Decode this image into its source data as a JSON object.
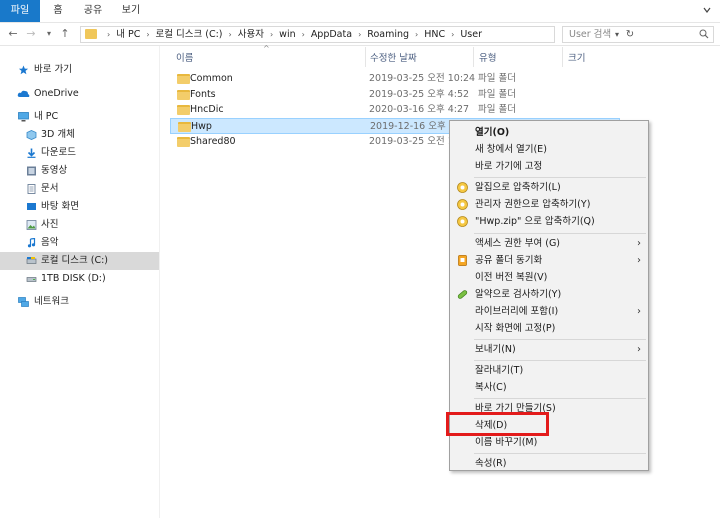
{
  "ribbon": {
    "tabs": [
      {
        "label": "파일",
        "active": true
      },
      {
        "label": "홈",
        "active": false
      },
      {
        "label": "공유",
        "active": false
      },
      {
        "label": "보기",
        "active": false
      }
    ]
  },
  "address": {
    "crumbs": [
      "내 PC",
      "로컬 디스크 (C:)",
      "사용자",
      "win",
      "AppData",
      "Roaming",
      "HNC",
      "User"
    ]
  },
  "search": {
    "placeholder": "User 검색"
  },
  "sidebar": {
    "items": [
      {
        "label": "바로 가기",
        "icon": "star-icon"
      },
      {
        "label": "OneDrive",
        "icon": "cloud-icon"
      },
      {
        "label": "내 PC",
        "icon": "computer-icon"
      },
      {
        "label": "3D 개체",
        "icon": "cube-icon"
      },
      {
        "label": "다운로드",
        "icon": "download-icon"
      },
      {
        "label": "동영상",
        "icon": "video-icon"
      },
      {
        "label": "문서",
        "icon": "document-icon"
      },
      {
        "label": "바탕 화면",
        "icon": "desktop-icon"
      },
      {
        "label": "사진",
        "icon": "picture-icon"
      },
      {
        "label": "음악",
        "icon": "music-icon"
      },
      {
        "label": "로컬 디스크 (C:)",
        "icon": "drive-icon",
        "selected": true
      },
      {
        "label": "1TB DISK (D:)",
        "icon": "drive-icon"
      },
      {
        "label": "네트워크",
        "icon": "network-icon"
      }
    ]
  },
  "columns": {
    "name": "이름",
    "date": "수정한 날짜",
    "type": "유형",
    "size": "크기"
  },
  "files": [
    {
      "name": "Common",
      "date": "2019-03-25 오전 10:24",
      "type": "파일 폴더"
    },
    {
      "name": "Fonts",
      "date": "2019-03-25 오후 4:52",
      "type": "파일 폴더"
    },
    {
      "name": "HncDic",
      "date": "2020-03-16 오후 4:27",
      "type": "파일 폴더"
    },
    {
      "name": "Hwp",
      "date": "2019-12-16 오후 4",
      "type": "",
      "selected": true
    },
    {
      "name": "Shared80",
      "date": "2019-03-25 오전 1",
      "type": ""
    }
  ],
  "context_menu": {
    "items": [
      {
        "label": "열기(O)",
        "bold": true
      },
      {
        "label": "새 창에서 열기(E)"
      },
      {
        "label": "바로 가기에 고정"
      },
      {
        "sep": true
      },
      {
        "label": "알집으로 압축하기(L)",
        "icon": "alzip-icon"
      },
      {
        "label": "관리자 권한으로 압축하기(Y)",
        "icon": "alzip-admin-icon"
      },
      {
        "label": "\"Hwp.zip\" 으로 압축하기(Q)",
        "icon": "alzip-zip-icon"
      },
      {
        "sep": true
      },
      {
        "label": "액세스 권한 부여 (G)",
        "submenu": true
      },
      {
        "label": "공유 폴더 동기화",
        "icon": "sync-icon",
        "submenu": true
      },
      {
        "label": "이전 버전 복원(V)"
      },
      {
        "label": "알약으로 검사하기(Y)",
        "icon": "alyac-icon"
      },
      {
        "label": "라이브러리에 포함(I)",
        "submenu": true
      },
      {
        "label": "시작 화면에 고정(P)"
      },
      {
        "sep": true
      },
      {
        "label": "보내기(N)",
        "submenu": true
      },
      {
        "sep": true
      },
      {
        "label": "잘라내기(T)"
      },
      {
        "label": "복사(C)"
      },
      {
        "sep": true
      },
      {
        "label": "바로 가기 만들기(S)"
      },
      {
        "label": "삭제(D)",
        "highlighted": true
      },
      {
        "label": "이름 바꾸기(M)"
      },
      {
        "sep": true
      },
      {
        "label": "속성(R)"
      }
    ]
  },
  "colors": {
    "accent": "#1979ca",
    "highlight_box": "#e31b1b",
    "selection": "#cce8ff"
  }
}
